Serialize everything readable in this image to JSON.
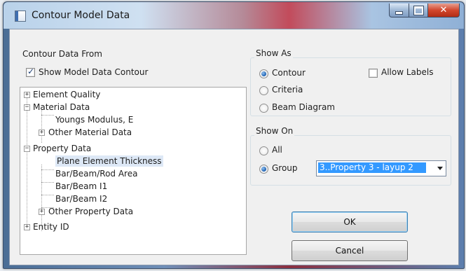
{
  "window": {
    "title": "Contour Model Data",
    "icons": {
      "app": "app-window-icon",
      "minimize": "minimize-icon",
      "maximize": "maximize-icon",
      "close": "close-icon"
    }
  },
  "contour_data_from": {
    "label": "Contour Data From",
    "show_model_data_contour": {
      "label": "Show Model Data Contour",
      "checked": true
    }
  },
  "tree": {
    "items": [
      {
        "label": "Element Quality",
        "expander": "+"
      },
      {
        "label": "Material Data",
        "expander": "−"
      },
      {
        "label": "Youngs Modulus, E"
      },
      {
        "label": "Other Material Data",
        "expander": "+"
      },
      {
        "label": "Property Data",
        "expander": "−"
      },
      {
        "label": "Plane Element Thickness",
        "selected": true
      },
      {
        "label": "Bar/Beam/Rod Area"
      },
      {
        "label": "Bar/Beam I1"
      },
      {
        "label": "Bar/Beam I2"
      },
      {
        "label": "Other Property Data",
        "expander": "+"
      },
      {
        "label": "Entity ID",
        "expander": "+"
      }
    ]
  },
  "show_as": {
    "label": "Show As",
    "options": [
      {
        "label": "Contour",
        "selected": true
      },
      {
        "label": "Criteria",
        "selected": false
      },
      {
        "label": "Beam Diagram",
        "selected": false
      }
    ],
    "allow_labels": {
      "label": "Allow Labels",
      "checked": false
    }
  },
  "show_on": {
    "label": "Show On",
    "options": [
      {
        "label": "All",
        "selected": false
      },
      {
        "label": "Group",
        "selected": true
      }
    ],
    "group_select": {
      "value": "3..Property 3 - layup 2"
    }
  },
  "buttons": {
    "ok": "OK",
    "cancel": "Cancel"
  },
  "colors": {
    "selection": "#3399ff",
    "tree_selection": "#dde8f6",
    "title_accent": "#c24b5b"
  }
}
